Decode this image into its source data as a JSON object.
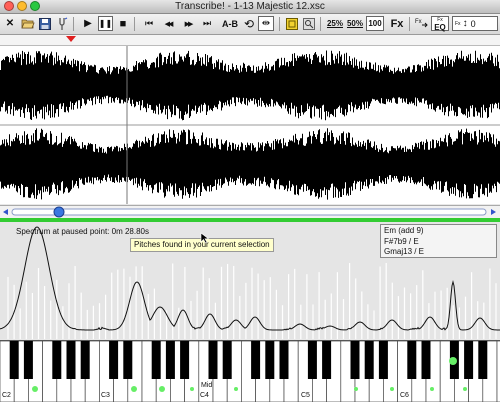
{
  "window": {
    "title": "Transcribe! - 1-13 Majestic 12.xsc"
  },
  "toolbar": {
    "buttons": [
      {
        "name": "close-doc-icon",
        "glyph": "✕"
      },
      {
        "name": "open-folder-icon",
        "glyph": ""
      },
      {
        "name": "save-icon",
        "glyph": ""
      },
      {
        "name": "tuning-fork-icon",
        "glyph": ""
      },
      {
        "name": "play-icon",
        "glyph": "▶"
      },
      {
        "name": "pause-icon",
        "glyph": "❚❚"
      },
      {
        "name": "stop-icon",
        "glyph": "■"
      },
      {
        "name": "skip-start-icon",
        "glyph": "⏮"
      },
      {
        "name": "rewind-icon",
        "glyph": "◀◀"
      },
      {
        "name": "fast-forward-icon",
        "glyph": "▶▶"
      },
      {
        "name": "skip-end-icon",
        "glyph": "⏭"
      },
      {
        "name": "ab-loop-button",
        "glyph": "A-B"
      },
      {
        "name": "loop-icon",
        "glyph": "⟲"
      },
      {
        "name": "split-icon",
        "glyph": "⇹"
      },
      {
        "name": "yellow-marker-icon",
        "glyph": ""
      },
      {
        "name": "zoom-icon",
        "glyph": ""
      }
    ],
    "speed_25": "25%",
    "speed_50": "50%",
    "speed_100": "100",
    "fx_label": "Fx",
    "fx_eq_label": "EQ",
    "fx_pitch_value": "0"
  },
  "spectrum": {
    "label": "Spectrum at paused point: 0m 28.80s",
    "tooltip": "Pitches found in your current selection",
    "chords": [
      "Em (add 9)",
      "F#7b9 / E",
      "Gmaj13 / E"
    ]
  },
  "keyboard": {
    "octave_labels": [
      "C2",
      "C3",
      "C4",
      "C5",
      "C6"
    ],
    "middle_label": "Mid"
  },
  "colors": {
    "accent_green": "#33cc33",
    "note_dot": "#66ee66",
    "playhead": "#e02020"
  }
}
